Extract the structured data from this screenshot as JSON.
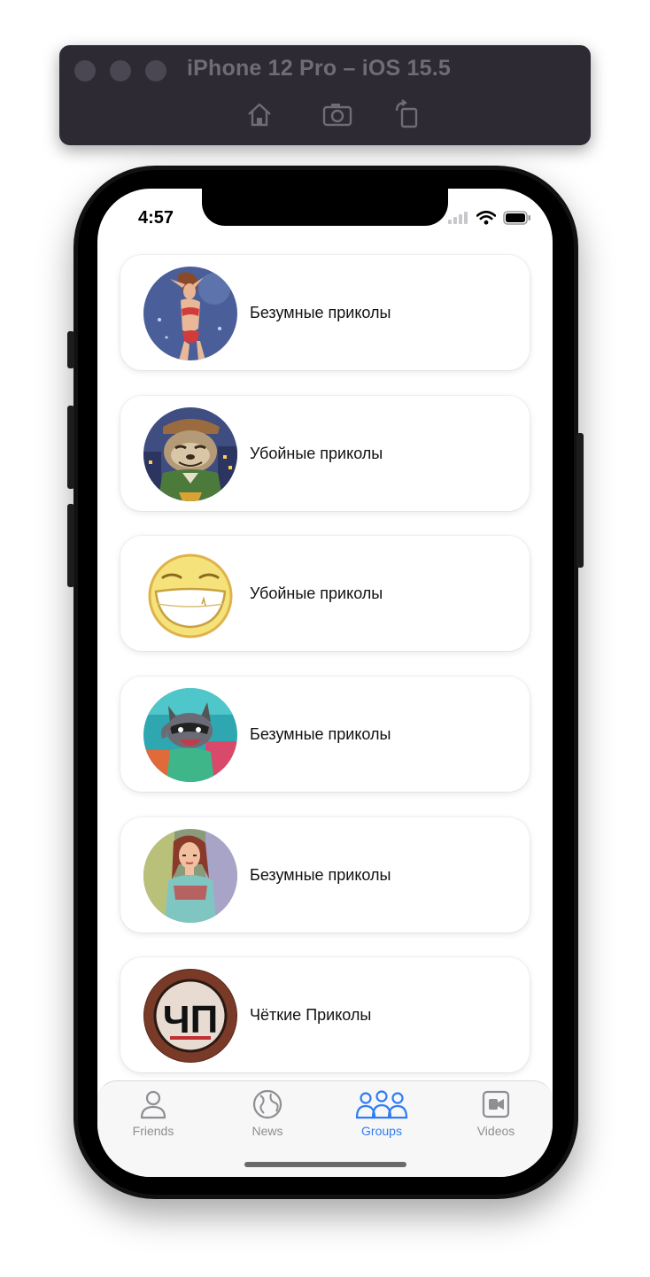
{
  "simulator": {
    "title": "iPhone 12 Pro – iOS 15.5",
    "buttons": [
      "home-icon",
      "screenshot-icon",
      "rotate-icon"
    ]
  },
  "status_bar": {
    "time": "4:57",
    "icons": [
      "cellular-icon",
      "wifi-icon",
      "battery-icon"
    ]
  },
  "groups": [
    {
      "name": "Безумные приколы",
      "avatar": "woman-swimsuit-avatar"
    },
    {
      "name": "Убойные приколы",
      "avatar": "sloth-avatar"
    },
    {
      "name": "Убойные приколы",
      "avatar": "laughing-smiley-avatar"
    },
    {
      "name": "Безумные приколы",
      "avatar": "raccoon-avatar"
    },
    {
      "name": "Безумные приколы",
      "avatar": "girl-tshirt-avatar"
    },
    {
      "name": "Чёткие Приколы",
      "avatar": "chp-logo-avatar"
    }
  ],
  "avatar_lettering": {
    "chp_logo": "ЧП"
  },
  "tab_bar": {
    "tabs": [
      {
        "label": "Friends",
        "icon": "person-icon",
        "active": false
      },
      {
        "label": "News",
        "icon": "globe-icon",
        "active": false
      },
      {
        "label": "Groups",
        "icon": "people-icon",
        "active": true
      },
      {
        "label": "Videos",
        "icon": "video-icon",
        "active": false
      }
    ]
  },
  "colors": {
    "accent": "#2f7cf6",
    "inactive": "#8e8e93",
    "sim_bar": "#2d2a33"
  }
}
